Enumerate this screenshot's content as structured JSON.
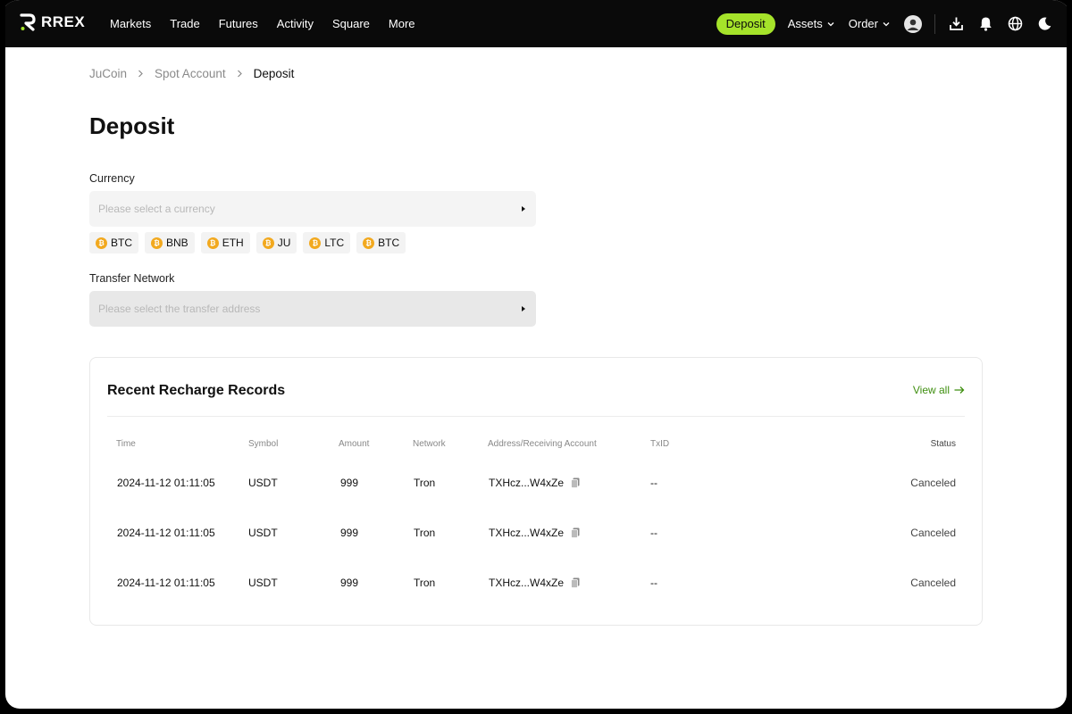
{
  "brand": {
    "name": "RREX",
    "accent": "#a5e32a"
  },
  "nav": {
    "links": [
      "Markets",
      "Trade",
      "Futures",
      "Activity",
      "Square",
      "More"
    ],
    "deposit_label": "Deposit",
    "assets_label": "Assets",
    "order_label": "Order",
    "icons": [
      "user-avatar-icon",
      "download-icon",
      "bell-icon",
      "globe-icon",
      "moon-icon"
    ]
  },
  "breadcrumb": [
    "JuCoin",
    "Spot Account",
    "Deposit"
  ],
  "page_title": "Deposit",
  "currency": {
    "label": "Currency",
    "placeholder": "Please select a currency",
    "quick_picks": [
      "BTC",
      "BNB",
      "ETH",
      "JU",
      "LTC",
      "BTC"
    ]
  },
  "network": {
    "label": "Transfer Network",
    "placeholder": "Please select the transfer address"
  },
  "records": {
    "title": "Recent Recharge Records",
    "view_all": "View all",
    "columns": [
      "Time",
      "Symbol",
      "Amount",
      "Network",
      "Address/Receiving Account",
      "TxID",
      "Status"
    ],
    "rows": [
      {
        "time": "2024-11-12 01:11:05",
        "symbol": "USDT",
        "amount": "999",
        "network": "Tron",
        "address": "TXHcz...W4xZe",
        "txid": "--",
        "status": "Canceled"
      },
      {
        "time": "2024-11-12 01:11:05",
        "symbol": "USDT",
        "amount": "999",
        "network": "Tron",
        "address": "TXHcz...W4xZe",
        "txid": "--",
        "status": "Canceled"
      },
      {
        "time": "2024-11-12 01:11:05",
        "symbol": "USDT",
        "amount": "999",
        "network": "Tron",
        "address": "TXHcz...W4xZe",
        "txid": "--",
        "status": "Canceled"
      }
    ]
  }
}
